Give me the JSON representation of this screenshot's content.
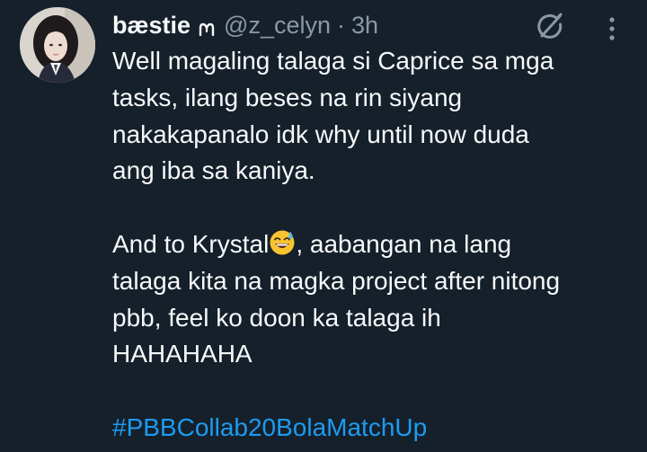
{
  "tweet": {
    "display_name": "bæstie",
    "handle": "@z_celyn",
    "separator": "·",
    "time": "3h",
    "paragraph1": [
      "Well magaling talaga si Caprice sa mga",
      "tasks, ilang beses na rin siyang",
      "nakakapanalo idk why until now duda",
      "ang iba sa kaniya."
    ],
    "paragraph2": {
      "line1_before_emoji": "And to Krystal",
      "emoji": "grinning-face-with-sweat",
      "line1_after_emoji": ", aabangan na lang",
      "lines": [
        "talaga kita na magka project after nitong",
        "pbb, feel ko doon ka talaga ih",
        "HAHAHAHA"
      ]
    },
    "hashtag": "#PBBCollab20BolaMatchUp"
  },
  "icons": {
    "name_badge": "cloud-mark-icon",
    "grok": "grok-icon",
    "more": "more-vertical-icon"
  },
  "colors": {
    "background": "#15202b",
    "primary_text": "#f7f9f9",
    "secondary_text": "#8b98a5",
    "link": "#1d9bf0"
  }
}
